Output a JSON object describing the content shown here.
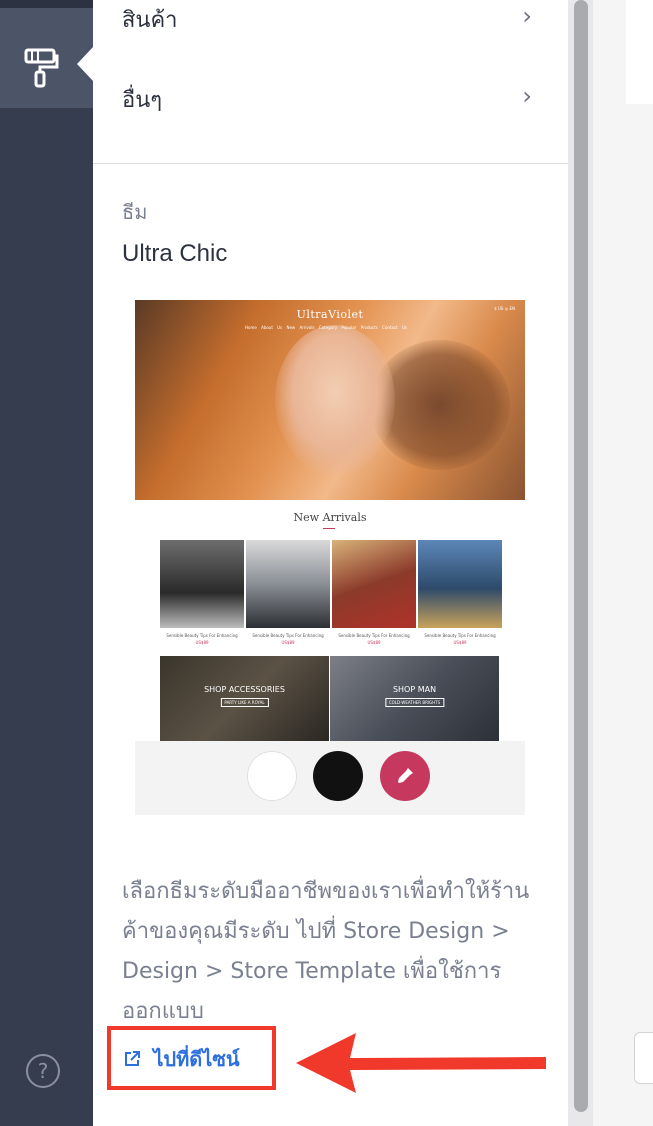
{
  "sidebar": {
    "active_tool": "paint-roller-icon",
    "help_symbol": "?"
  },
  "menu": {
    "items": [
      {
        "label": "สินค้า",
        "chevron": "›"
      },
      {
        "label": "อื่นๆ",
        "chevron": "›"
      }
    ]
  },
  "theme": {
    "section_label": "ธีม",
    "name": "Ultra Chic",
    "preview": {
      "brand": "UltraViolet",
      "nav": "Home About Us New Arrivals Category Popular Products Contact Us",
      "utilities": "$ US  ◎ EN",
      "heading": "New Arrivals",
      "products": [
        {
          "caption": "Sensible Beauty Tips For Enhancing",
          "price": "US$89"
        },
        {
          "caption": "Sensible Beauty Tips For Enhancing",
          "price": "US$89"
        },
        {
          "caption": "Sensible Beauty Tips For Enhancing",
          "price": "US$89"
        },
        {
          "caption": "Sensible Beauty Tips For Enhancing",
          "price": "US$89"
        }
      ],
      "promos": [
        {
          "title": "SHOP ACCESSORIES",
          "subtitle": "PARTY LIKE A ROYAL"
        },
        {
          "title": "SHOP MAN",
          "subtitle": "COLD-WEATHER BRIGHTS"
        }
      ]
    },
    "swatches": [
      {
        "name": "white",
        "color": "#ffffff"
      },
      {
        "name": "black",
        "color": "#111111"
      },
      {
        "name": "custom-picker",
        "color": "#c7385f",
        "icon": "eyedropper-icon"
      }
    ]
  },
  "description": "เลือกธีมระดับมืออาชีพของเราเพื่อทำให้ร้านค้าของคุณมีระดับ ไปที่ Store Design > Design > Store Template เพื่อใช้การออกแบบ",
  "link": {
    "icon": "external-link-icon",
    "label": "ไปที่ดีไซน์"
  },
  "colors": {
    "rail": "#363d4f",
    "accent_link": "#2e6fe0",
    "highlight": "#f0392a",
    "swatch_pink": "#c7385f"
  }
}
